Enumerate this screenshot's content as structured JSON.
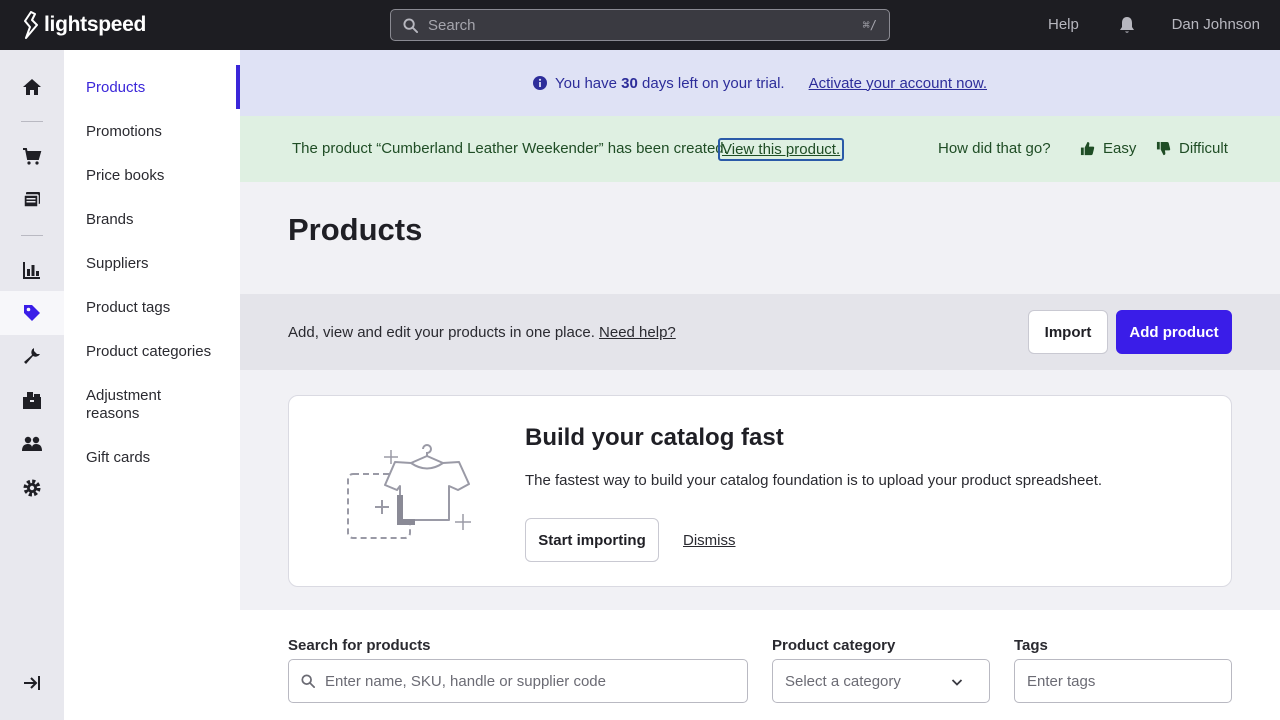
{
  "app": {
    "brand": "lightspeed"
  },
  "topbar": {
    "search_placeholder": "Search",
    "search_shortcut": "⌘/",
    "help_label": "Help",
    "user_name": "Dan Johnson",
    "bell_icon": "bell-icon"
  },
  "rail": {
    "items": [
      {
        "icon": "home-icon"
      },
      {
        "icon": "cart-icon"
      },
      {
        "icon": "register-icon"
      },
      {
        "icon": "reports-icon"
      },
      {
        "icon": "tag-icon",
        "active": true
      },
      {
        "icon": "tools-icon"
      },
      {
        "icon": "inventory-icon"
      },
      {
        "icon": "customers-icon"
      },
      {
        "icon": "gear-icon"
      },
      {
        "icon": "expand-icon"
      }
    ]
  },
  "subnav": {
    "items": [
      {
        "label": "Products",
        "active": true
      },
      {
        "label": "Promotions"
      },
      {
        "label": "Price books"
      },
      {
        "label": "Brands"
      },
      {
        "label": "Suppliers"
      },
      {
        "label": "Product tags"
      },
      {
        "label": "Product categories"
      },
      {
        "label": "Adjustment reasons"
      },
      {
        "label": "Gift cards"
      }
    ]
  },
  "trial": {
    "prefix": "You have ",
    "days": "30",
    "suffix": " days left on your trial.",
    "link": "Activate your account now."
  },
  "toast": {
    "message": "The product “Cumberland Leather Weekender” has been created.",
    "link": "View this product.",
    "question": "How did that go?",
    "easy": "Easy",
    "difficult": "Difficult"
  },
  "page": {
    "title": "Products"
  },
  "actionbar": {
    "description": "Add, view and edit your products in one place.",
    "help_link": "Need help?",
    "import_label": "Import",
    "add_label": "Add product"
  },
  "card": {
    "title": "Build your catalog fast",
    "text": "The fastest way to build your catalog foundation is to upload your product spreadsheet.",
    "start_label": "Start importing",
    "dismiss_label": "Dismiss"
  },
  "filters": {
    "search_label": "Search for products",
    "search_placeholder": "Enter name, SKU, handle or supplier code",
    "category_label": "Product category",
    "category_value": "Select a category",
    "tags_label": "Tags",
    "tags_placeholder": "Enter tags"
  },
  "colors": {
    "accent": "#3a1de8",
    "topbar": "#1d1d22",
    "trial_bg": "#dfe2f5",
    "success_bg": "#dff0e2"
  }
}
